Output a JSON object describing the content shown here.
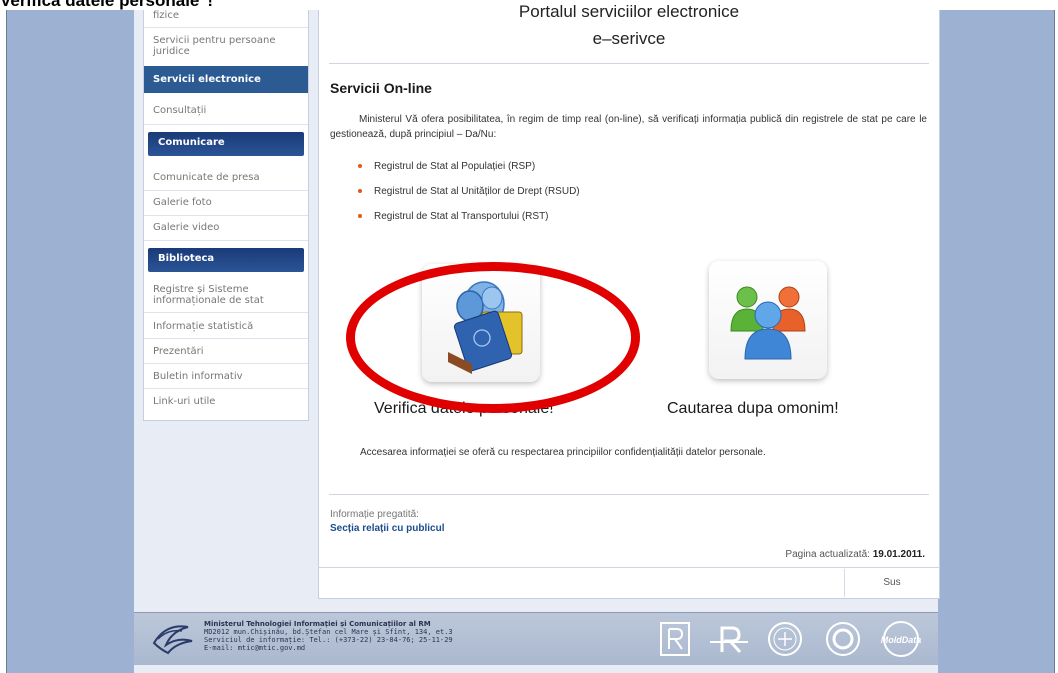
{
  "top_caption": "Verifica datele personale\"!",
  "sidebar": {
    "items": [
      {
        "label": "fizice"
      },
      {
        "label": "Servicii pentru persoane juridice"
      },
      {
        "label": "Servicii electronice"
      },
      {
        "label": "Consultații"
      }
    ],
    "sections": [
      {
        "title": "Comunicare",
        "items": [
          "Comunicate de presa",
          "Galerie foto",
          "Galerie video"
        ]
      },
      {
        "title": "Biblioteca",
        "items": [
          "Registre și Sisteme informaționale de stat",
          "Informație statistică",
          "Prezentări",
          "Buletin informativ",
          "Link-uri utile"
        ]
      }
    ]
  },
  "main": {
    "portal_title": "Portalul serviciilor electronice",
    "portal_subtitle": "e–serivce",
    "section_title": "Servicii On-line",
    "intro": "Ministerul Vă ofera posibilitatea, în regim de timp real (on-line), să verificați informația publică din registrele de stat pe care le gestionează, după principiul – Da/Nu:",
    "registries": [
      "Registrul de Stat al Populației (RSP)",
      "Registrul de Stat al Unităților de Drept (RSUD)",
      "Registrul de Stat al Transportului (RST)"
    ],
    "services": [
      {
        "label": "Verifica datele personale!",
        "icon": "passport-users-icon"
      },
      {
        "label": "Cautarea dupa omonim!",
        "icon": "users-group-icon"
      }
    ],
    "access_note": "Accesarea informației se oferă cu respectarea principiilor confidențialității datelor personale.",
    "info_label": "Informație pregatită:",
    "info_link": "Secția relații cu publicul",
    "updated_label": "Pagina actualizată:",
    "updated_date": "19.01.2011.",
    "back_to_top": "Sus"
  },
  "footer": {
    "org_name": "Ministerul Tehnologiei Informației și Comunicațiilor al RM",
    "address": "MD2012 mun.Chișinău, bd.Ștefan cel Mare și Sfînt, 134, et.3",
    "phone": "Serviciul de informație: Tel.: (+373-22) 23-84-76; 25-11-29",
    "email": "E-mail: mtic@mtic.gov.md",
    "partner_text": "MoldData"
  },
  "colors": {
    "frame": "#9db1d3",
    "sidebar_active": "#2c5a92",
    "sidebar_head": "#1a3a78",
    "bullet": "#e05a1a",
    "highlight": "#e00000",
    "link": "#1d4d8f"
  }
}
